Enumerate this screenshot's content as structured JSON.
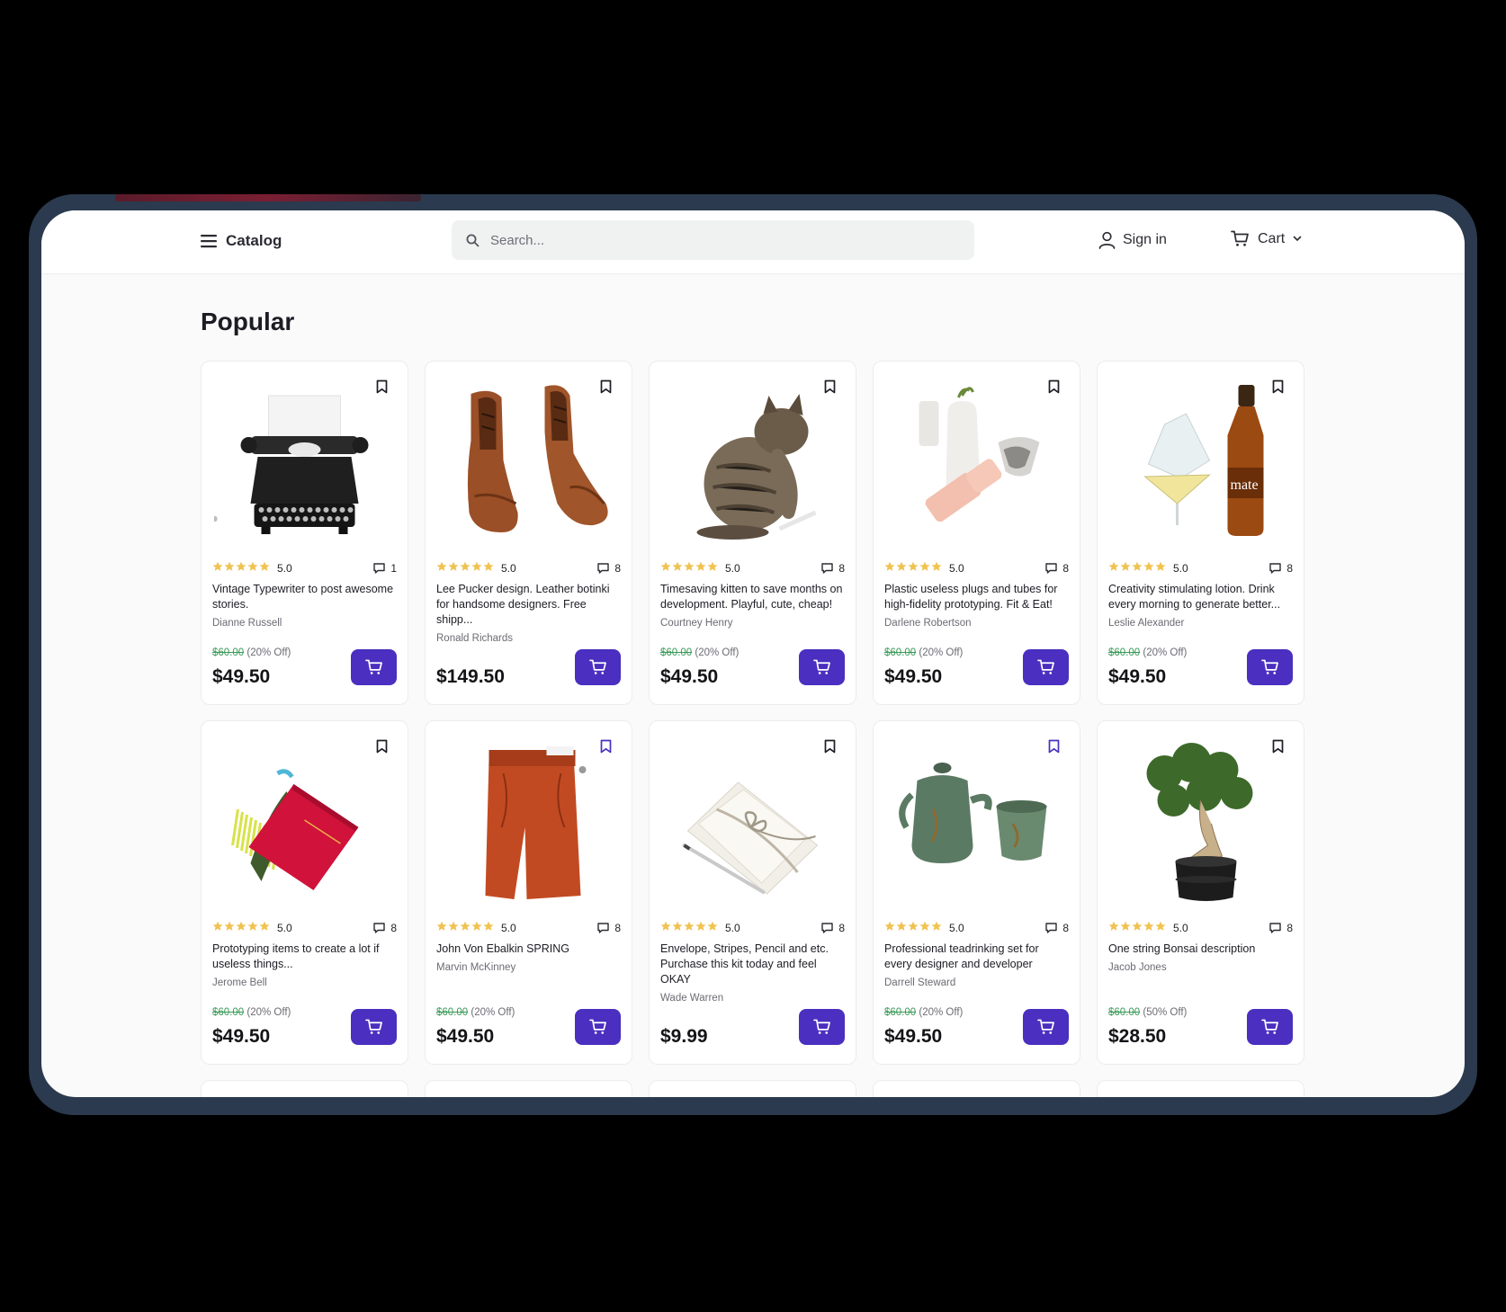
{
  "header": {
    "catalog_label": "Catalog",
    "search_placeholder": "Search...",
    "signin_label": "Sign in",
    "cart_label": "Cart"
  },
  "section_title": "Popular",
  "colors": {
    "accent": "#4a2fc0",
    "star": "#f0c24f",
    "old_price": "#3a9a58"
  },
  "products": [
    {
      "title": "Vintage Typewriter to post awesome stories.",
      "seller": "Dianne Russell",
      "rating": "5.0",
      "reviews": "1",
      "old_price": "$60.00",
      "discount": "(20% Off)",
      "price": "$49.50",
      "bookmarked": false,
      "image": "typewriter-image"
    },
    {
      "title": "Lee Pucker design. Leather botinki for handsome designers. Free shipp...",
      "seller": "Ronald Richards",
      "rating": "5.0",
      "reviews": "8",
      "old_price": "",
      "discount": "",
      "price": "$149.50",
      "bookmarked": false,
      "image": "leather-boots-image"
    },
    {
      "title": "Timesaving kitten to save months on development. Playful, cute, cheap!",
      "seller": "Courtney Henry",
      "rating": "5.0",
      "reviews": "8",
      "old_price": "$60.00",
      "discount": "(20% Off)",
      "price": "$49.50",
      "bookmarked": false,
      "image": "kitten-image"
    },
    {
      "title": "Plastic useless plugs and tubes for high-fidelity prototyping. Fit & Eat!",
      "seller": "Darlene Robertson",
      "rating": "5.0",
      "reviews": "8",
      "old_price": "$60.00",
      "discount": "(20% Off)",
      "price": "$49.50",
      "bookmarked": false,
      "image": "plugs-tubes-image"
    },
    {
      "title": "Creativity stimulating lotion. Drink every morning to generate better...",
      "seller": "Leslie Alexander",
      "rating": "5.0",
      "reviews": "8",
      "old_price": "$60.00",
      "discount": "(20% Off)",
      "price": "$49.50",
      "bookmarked": false,
      "image": "mate-bottle-image"
    },
    {
      "title": "Prototyping items to create a lot if useless things...",
      "seller": "Jerome Bell",
      "rating": "5.0",
      "reviews": "8",
      "old_price": "$60.00",
      "discount": "(20% Off)",
      "price": "$49.50",
      "bookmarked": false,
      "image": "notebook-image"
    },
    {
      "title": "John Von Ebalkin SPRING",
      "seller": "Marvin McKinney",
      "rating": "5.0",
      "reviews": "8",
      "old_price": "$60.00",
      "discount": "(20% Off)",
      "price": "$49.50",
      "bookmarked": true,
      "image": "pants-image"
    },
    {
      "title": "Envelope, Stripes, Pencil and etc. Purchase this kit today and feel OKAY",
      "seller": "Wade Warren",
      "rating": "5.0",
      "reviews": "8",
      "old_price": "",
      "discount": "",
      "price": "$9.99",
      "bookmarked": false,
      "image": "envelope-kit-image"
    },
    {
      "title": "Professional teadrinking set for every designer and developer",
      "seller": "Darrell Steward",
      "rating": "5.0",
      "reviews": "8",
      "old_price": "$60.00",
      "discount": "(20% Off)",
      "price": "$49.50",
      "bookmarked": true,
      "image": "tea-set-image"
    },
    {
      "title": "One string Bonsai description",
      "seller": "Jacob Jones",
      "rating": "5.0",
      "reviews": "8",
      "old_price": "$60.00",
      "discount": "(50% Off)",
      "price": "$28.50",
      "bookmarked": false,
      "image": "bonsai-image"
    }
  ]
}
